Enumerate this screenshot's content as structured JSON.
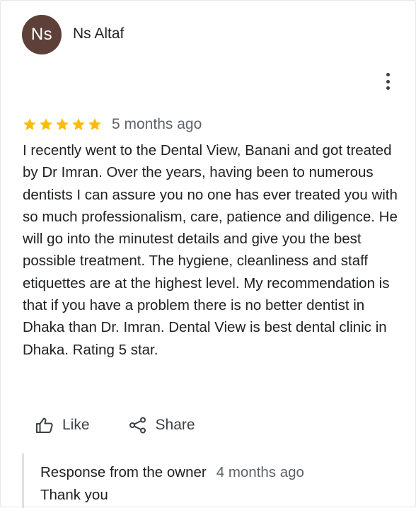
{
  "review": {
    "author_initials": "Ns",
    "author_name": "Ns Altaf",
    "rating": 5,
    "max_rating": 5,
    "time_ago": "5 months ago",
    "text": "I recently went to the Dental View, Banani and got treated by Dr Imran. Over the years, having been to numerous dentists I can assure you no one has ever treated you with so much professionalism, care, patience and diligence. He will go into the minutest details and give you the best possible treatment. The hygiene, cleanliness and staff etiquettes are at the highest level. My recommendation is that if you have a problem there is no better dentist in Dhaka than Dr. Imran. Dental View is best dental clinic in Dhaka. Rating 5 star."
  },
  "actions": {
    "like_label": "Like",
    "like_icon": "thumbs-up-icon",
    "share_label": "Share",
    "share_icon": "share-icon",
    "more_icon": "more-vert-icon"
  },
  "owner_response": {
    "title": "Response from the owner",
    "time_ago": "4 months ago",
    "text": "Thank you"
  },
  "colors": {
    "avatar_bg": "#5d4037",
    "star": "#fbbc04",
    "text": "#202124",
    "secondary": "#5f6368"
  }
}
